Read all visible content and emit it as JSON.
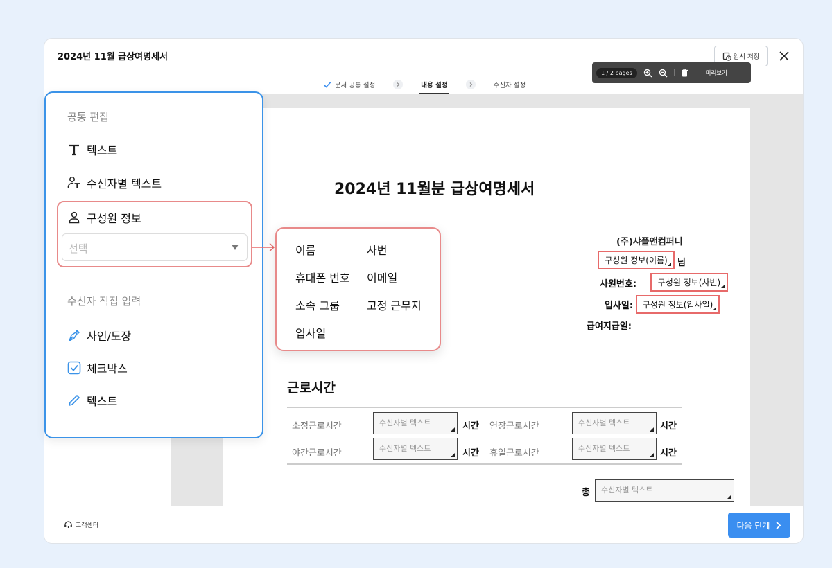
{
  "window": {
    "title": "2024년 11월 급상여명세서",
    "save_label": "임시 저장"
  },
  "steps": [
    {
      "label": "문서 공통 설정",
      "status": "done"
    },
    {
      "label": "내용 설정",
      "status": "active"
    },
    {
      "label": "수신자 설정",
      "status": "pending"
    }
  ],
  "viewer": {
    "pages": "1 / 2 pages",
    "preview_label": "미리보기"
  },
  "document": {
    "title": "2024년 11월분 급상여명세서",
    "company": "(주)샤플앤컴퍼니",
    "name_field": "구성원 정보(이름)",
    "name_suffix": "님",
    "emp_no_label": "사원번호:",
    "emp_no_field": "구성원 정보(사번)",
    "join_label": "입사일:",
    "join_field": "구성원 정보(입사일)",
    "payday_label": "급여지급일:",
    "work_section": "근로시간",
    "rows": [
      {
        "left_label": "소정근로시간",
        "left_placeholder": "수신자별 텍스트",
        "left_unit": "시간",
        "right_label": "연장근로시간",
        "right_placeholder": "수신자별 텍스트",
        "right_unit": "시간"
      },
      {
        "left_label": "야간근로시간",
        "left_placeholder": "수신자별 텍스트",
        "left_unit": "시간",
        "right_label": "휴일근로시간",
        "right_placeholder": "수신자별 텍스트",
        "right_unit": "시간"
      }
    ],
    "total_label": "총",
    "total_placeholder": "수신자별 텍스트"
  },
  "side_panel": {
    "common_heading": "공통 편집",
    "common_items": [
      {
        "label": "텍스트",
        "icon": "text-t-icon"
      },
      {
        "label": "수신자별 텍스트",
        "icon": "person-text-icon"
      },
      {
        "label": "구성원 정보",
        "icon": "person-icon"
      }
    ],
    "select_placeholder": "선택",
    "direct_heading": "수신자 직접 입력",
    "direct_items": [
      {
        "label": "사인/도장",
        "icon": "pen-nib-icon"
      },
      {
        "label": "체크박스",
        "icon": "checkbox-icon"
      },
      {
        "label": "텍스트",
        "icon": "pencil-icon"
      }
    ]
  },
  "member_options": [
    "이름",
    "사번",
    "휴대폰 번호",
    "이메일",
    "소속 그룹",
    "고정 근무지",
    "입사일"
  ],
  "footer": {
    "help_label": "고객센터",
    "next_label": "다음 단계"
  },
  "colors": {
    "accent": "#3a8ef0",
    "panel_border": "#3b93e8",
    "highlight_red": "#e76a6a",
    "background": "#e8f1fc"
  }
}
